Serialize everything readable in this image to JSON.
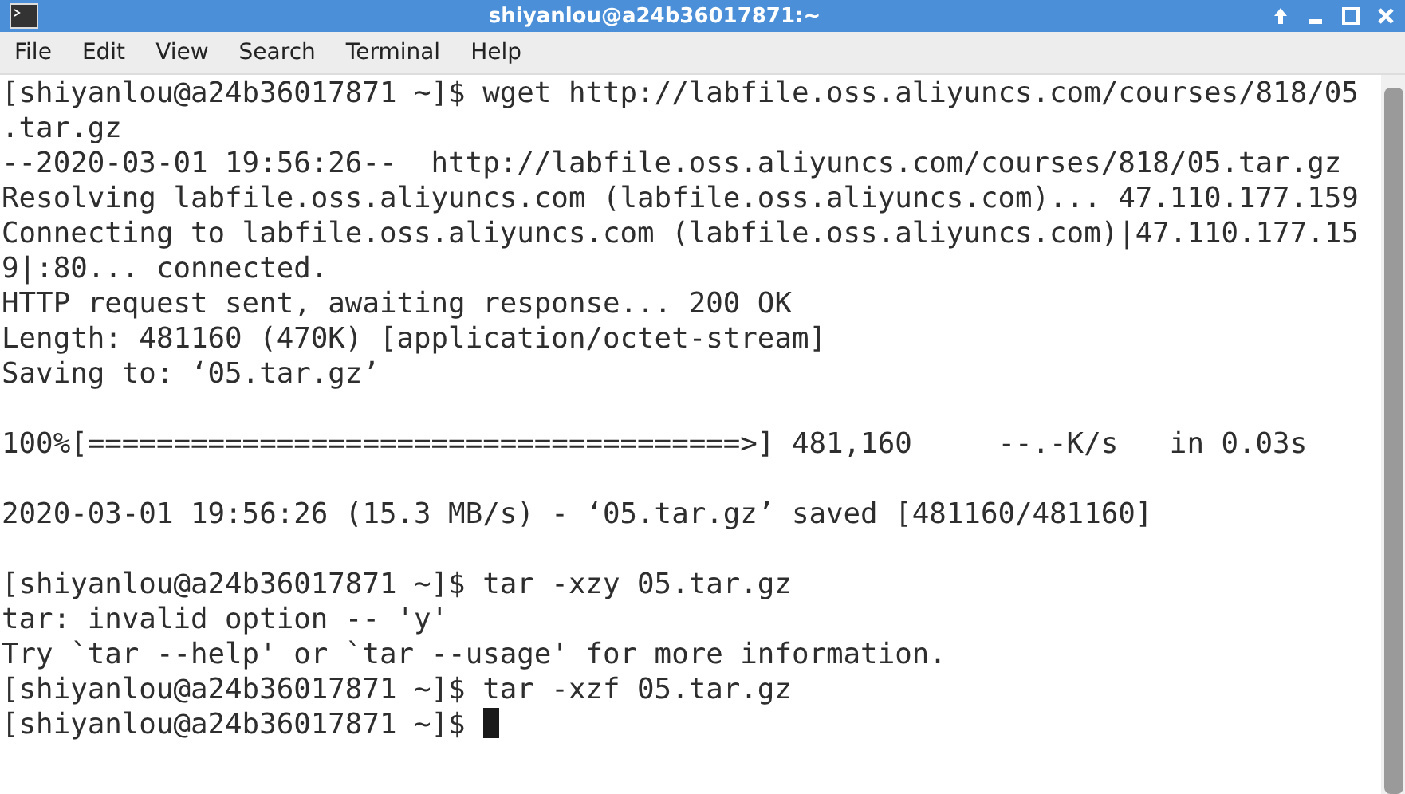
{
  "window": {
    "title": "shiyanlou@a24b36017871:~"
  },
  "menu": [
    "File",
    "Edit",
    "View",
    "Search",
    "Terminal",
    "Help"
  ],
  "terminal": {
    "lines": [
      {
        "kind": "text",
        "text": "[shiyanlou@a24b36017871 ~]$ wget http://labfile.oss.aliyuncs.com/courses/818/05"
      },
      {
        "kind": "text",
        "text": ".tar.gz"
      },
      {
        "kind": "text",
        "text": "--2020-03-01 19:56:26--  http://labfile.oss.aliyuncs.com/courses/818/05.tar.gz"
      },
      {
        "kind": "text",
        "text": "Resolving labfile.oss.aliyuncs.com (labfile.oss.aliyuncs.com)... 47.110.177.159"
      },
      {
        "kind": "text",
        "text": "Connecting to labfile.oss.aliyuncs.com (labfile.oss.aliyuncs.com)|47.110.177.15"
      },
      {
        "kind": "text",
        "text": "9|:80... connected."
      },
      {
        "kind": "text",
        "text": "HTTP request sent, awaiting response... 200 OK"
      },
      {
        "kind": "text",
        "text": "Length: 481160 (470K) [application/octet-stream]"
      },
      {
        "kind": "text",
        "text": "Saving to: ‘05.tar.gz’"
      },
      {
        "kind": "blank"
      },
      {
        "kind": "text",
        "text": "100%[======================================>] 481,160     --.-K/s   in 0.03s"
      },
      {
        "kind": "blank"
      },
      {
        "kind": "text",
        "text": "2020-03-01 19:56:26 (15.3 MB/s) - ‘05.tar.gz’ saved [481160/481160]"
      },
      {
        "kind": "blank"
      },
      {
        "kind": "text",
        "text": "[shiyanlou@a24b36017871 ~]$ tar -xzy 05.tar.gz"
      },
      {
        "kind": "text",
        "text": "tar: invalid option -- 'y'"
      },
      {
        "kind": "text",
        "text": "Try `tar --help' or `tar --usage' for more information."
      },
      {
        "kind": "text",
        "text": "[shiyanlou@a24b36017871 ~]$ tar -xzf 05.tar.gz"
      },
      {
        "kind": "text",
        "text": "[shiyanlou@a24b36017871 ~]$ ",
        "cursor": true
      }
    ]
  }
}
